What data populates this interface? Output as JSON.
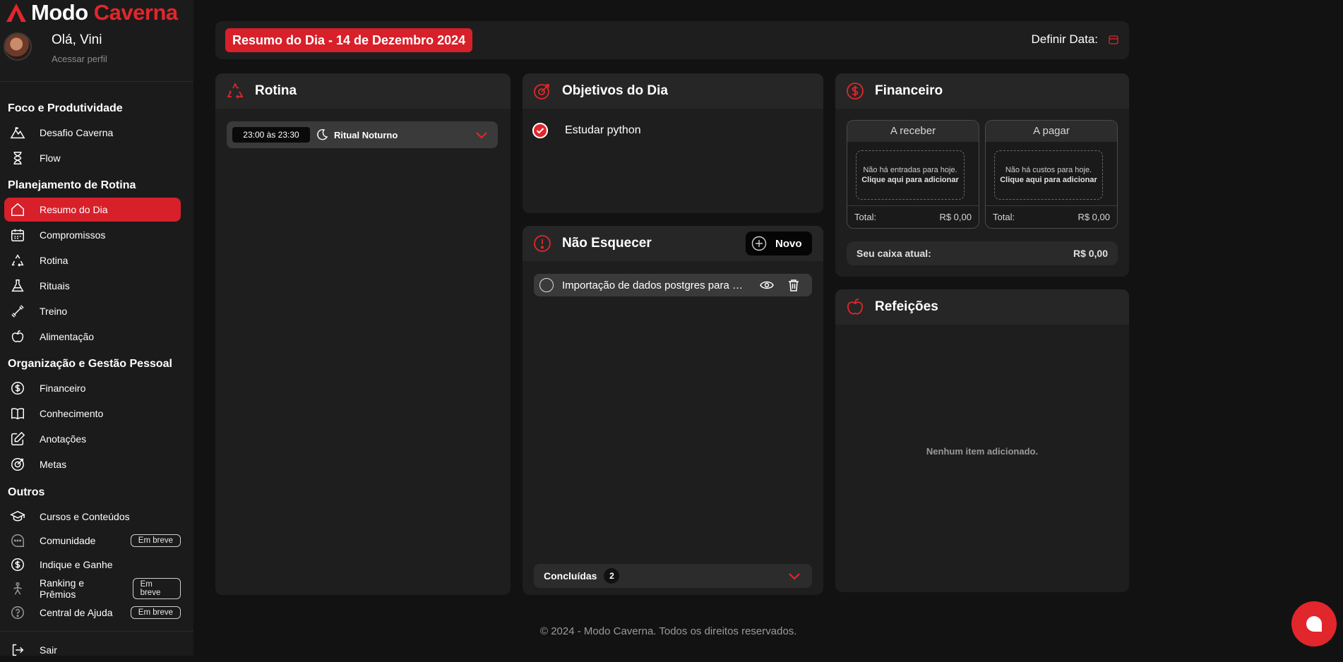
{
  "brand": {
    "part1": "Modo",
    "part2": "Caverna",
    "logo_icon": "mountain-icon"
  },
  "profile": {
    "greeting": "Olá, Vini",
    "link": "Acessar perfil"
  },
  "sidebar": {
    "sections": [
      {
        "title": "Foco e Produtividade"
      },
      {
        "title": "Planejamento de Rotina"
      },
      {
        "title": "Organização e Gestão Pessoal"
      },
      {
        "title": "Outros"
      }
    ],
    "items": [
      {
        "label": "Desafio Caverna",
        "icon": "mountain-icon"
      },
      {
        "label": "Flow",
        "icon": "hourglass-icon"
      },
      {
        "label": "Resumo do Dia",
        "icon": "home-icon",
        "active": true
      },
      {
        "label": "Compromissos",
        "icon": "calendar-icon"
      },
      {
        "label": "Rotina",
        "icon": "recycle-icon"
      },
      {
        "label": "Rituais",
        "icon": "flask-icon"
      },
      {
        "label": "Treino",
        "icon": "dumbbell-icon"
      },
      {
        "label": "Alimentação",
        "icon": "apple-icon"
      },
      {
        "label": "Financeiro",
        "icon": "dollar-icon"
      },
      {
        "label": "Conhecimento",
        "icon": "book-icon"
      },
      {
        "label": "Anotações",
        "icon": "edit-icon"
      },
      {
        "label": "Metas",
        "icon": "target-icon"
      },
      {
        "label": "Cursos e Conteúdos",
        "icon": "graduation-cap-icon"
      },
      {
        "label": "Comunidade",
        "icon": "chat-icon",
        "badge": "Em breve"
      },
      {
        "label": "Indique e Ganhe",
        "icon": "dollar-icon"
      },
      {
        "label": "Ranking e Prêmios",
        "icon": "trophy-icon",
        "badge": "Em breve"
      },
      {
        "label": "Central de Ajuda",
        "icon": "help-icon",
        "badge": "Em breve"
      },
      {
        "label": "Sair",
        "icon": "logout-icon"
      }
    ]
  },
  "header": {
    "title": "Resumo do Dia - 14 de Dezembro 2024",
    "set_date_label": "Definir Data:"
  },
  "routine": {
    "title": "Rotina",
    "entry": {
      "time": "23:00 às 23:30",
      "name": "Ritual Noturno"
    }
  },
  "goals": {
    "title": "Objetivos do Dia",
    "items": [
      {
        "label": "Estudar python",
        "done": true
      }
    ]
  },
  "reminders": {
    "title": "Não Esquecer",
    "new_label": "Novo",
    "items": [
      {
        "label": "Importação de dados postgres para m..."
      }
    ],
    "done_label": "Concluídas",
    "done_count": "2"
  },
  "finance": {
    "title": "Financeiro",
    "receive": {
      "title": "A receber",
      "empty1": "Não há entradas para hoje.",
      "empty2": "Clique aqui para adicionar",
      "total_label": "Total:",
      "total_value": "R$ 0,00"
    },
    "pay": {
      "title": "A pagar",
      "empty1": "Não há custos para hoje.",
      "empty2": "Clique aqui para adicionar",
      "total_label": "Total:",
      "total_value": "R$ 0,00"
    },
    "balance_label": "Seu caixa atual:",
    "balance_value": "R$ 0,00"
  },
  "meals": {
    "title": "Refeições",
    "empty": "Nenhum item adicionado."
  },
  "footer": "© 2024 - Modo Caverna. Todos os direitos reservados.",
  "colors": {
    "accent": "#d8202a",
    "background": "#121212",
    "card": "#1e1e1e",
    "sidebar": "#1b1b1b"
  }
}
